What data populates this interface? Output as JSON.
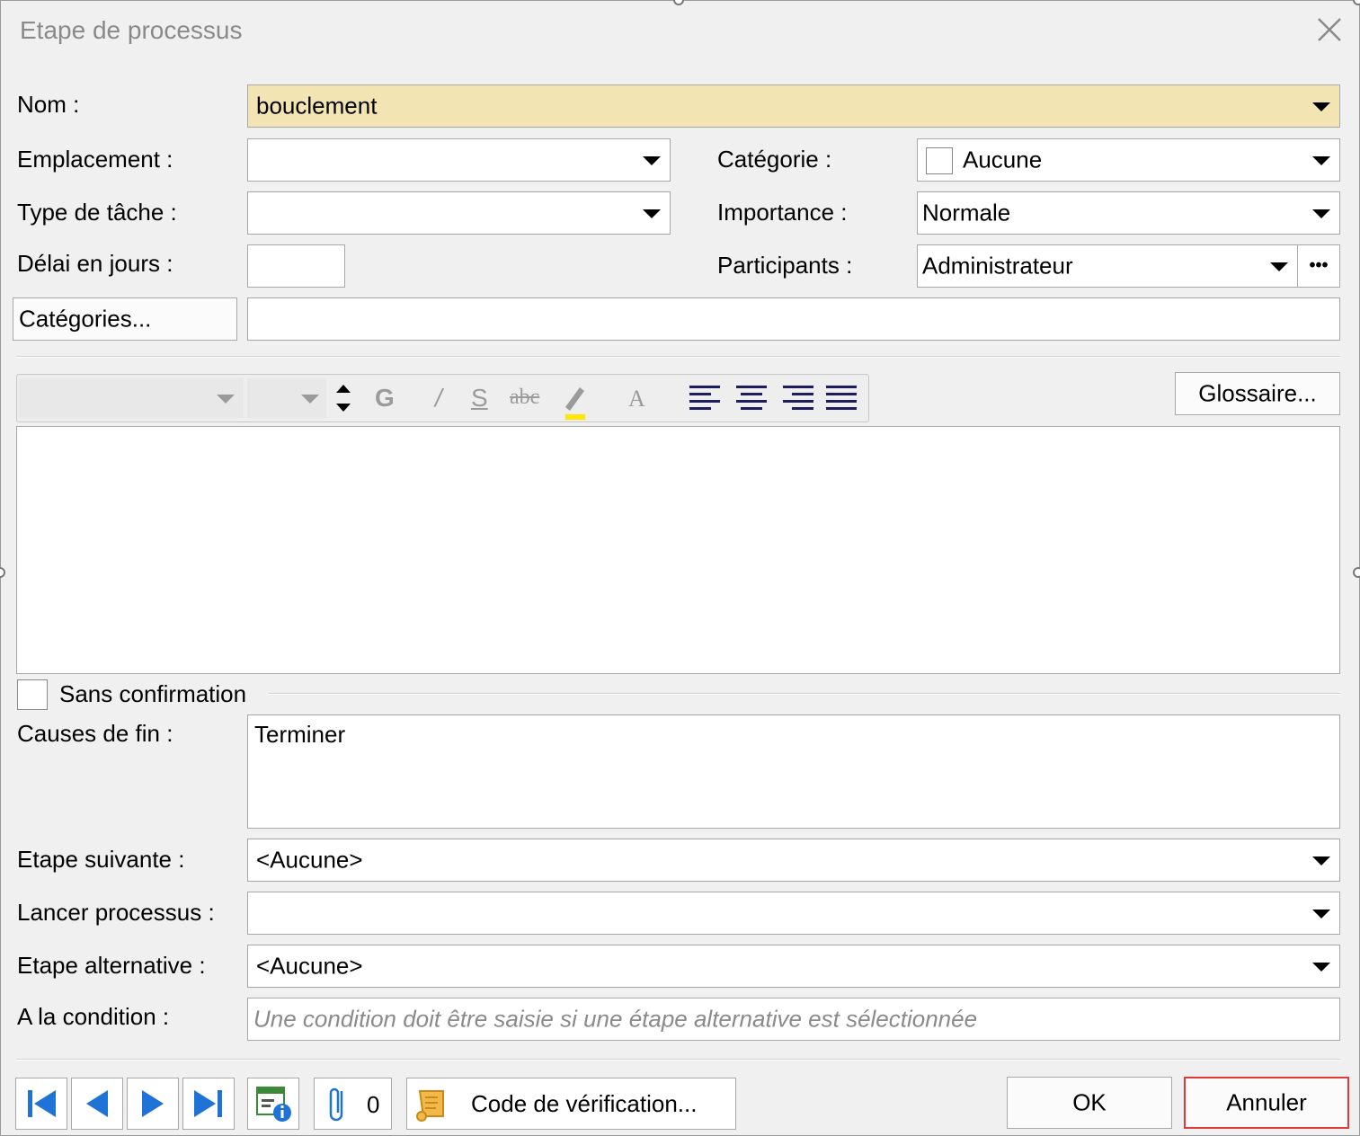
{
  "window": {
    "title": "Etape de processus",
    "close_icon": "close-icon"
  },
  "form": {
    "nom_label": "Nom :",
    "nom_value": "bouclement",
    "emplacement_label": "Emplacement :",
    "emplacement_value": "",
    "type_tache_label": "Type de tâche :",
    "type_tache_value": "",
    "delai_label": "Délai en jours :",
    "delai_value": "",
    "categorie_label": "Catégorie :",
    "categorie_value": "Aucune",
    "importance_label": "Importance :",
    "importance_value": "Normale",
    "participants_label": "Participants :",
    "participants_value": "Administrateur",
    "participants_more": "•••",
    "categories_button": "Catégories...",
    "categories_value": ""
  },
  "editor": {
    "font_value": "",
    "size_value": "",
    "bold_label": "G",
    "italic_label": "/",
    "underline_label": "S",
    "strike_label": "abc",
    "color_label": "A",
    "glossaire_button": "Glossaire...",
    "content": ""
  },
  "options": {
    "sans_confirmation_label": "Sans confirmation",
    "sans_confirmation_checked": false,
    "causes_label": "Causes de fin :",
    "causes_items": [
      "Terminer"
    ],
    "etape_suivante_label": "Etape suivante :",
    "etape_suivante_value": "<Aucune>",
    "lancer_processus_label": "Lancer processus :",
    "lancer_processus_value": "",
    "etape_alternative_label": "Etape alternative :",
    "etape_alternative_value": "<Aucune>",
    "condition_label": "A la condition :",
    "condition_placeholder": "Une condition doit être saisie si une étape alternative est sélectionnée"
  },
  "footer": {
    "attachments_count": "0",
    "code_verification_button": "Code de vérification...",
    "ok_button": "OK",
    "cancel_button": "Annuler"
  },
  "colors": {
    "nom_background": "#f2e5b3",
    "cancel_border": "#e03a3a",
    "nav_blue": "#1f72d6",
    "highlight_yellow": "#ffe600"
  }
}
